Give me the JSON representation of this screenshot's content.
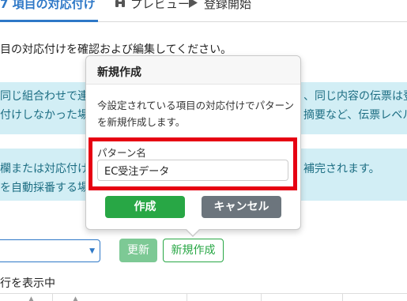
{
  "tabs": [
    {
      "label": "7 項目の対応付け",
      "active": true
    },
    {
      "label": "プレビュー",
      "icon": "binoculars-icon"
    },
    {
      "label": "登録開始",
      "icon": "play-icon"
    }
  ],
  "description": "目の対応付けを確認および編集してください。",
  "alert1": {
    "line1_left": "同じ組合わせで連結",
    "line1_right": "、同じ内容の伝票は登",
    "line2_left": "付けしなかった場合",
    "line2_right": "摘要など、伝票レベル"
  },
  "alert2": {
    "line1_left": "欄または対応付け",
    "line1_right": "補完されます。",
    "line2_left": "を自動採番する場"
  },
  "actions": {
    "update_label": "更新",
    "new_label": "新規作成"
  },
  "rows_info": "行を表示中",
  "popover": {
    "title": "新規作成",
    "body": "今設定されている項目の対応付けでパターンを新規作成します。",
    "field_label": "パターン名",
    "field_value": "EC受注データ",
    "create_label": "作成",
    "cancel_label": "キャンセル"
  },
  "colors": {
    "accent": "#2e78c7",
    "success": "#28a745",
    "secondary": "#6c757d",
    "highlight": "#e60012",
    "alert_bg": "#d2eef5"
  }
}
